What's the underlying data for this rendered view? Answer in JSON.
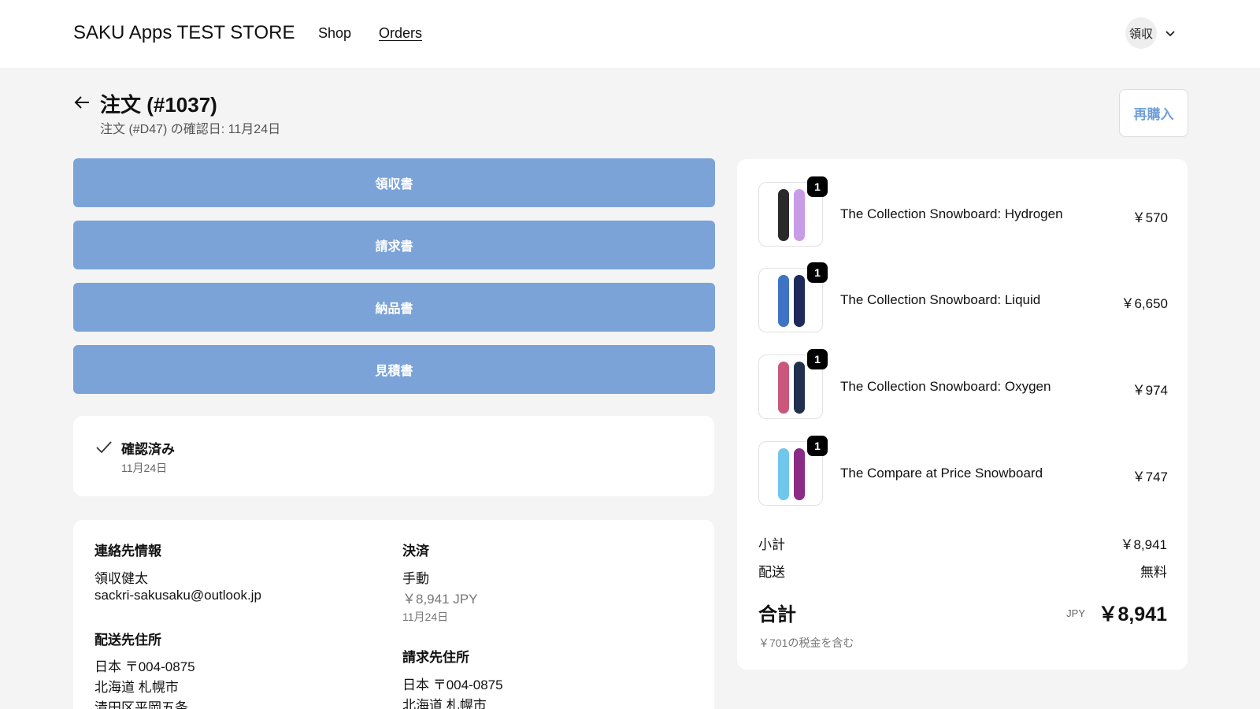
{
  "header": {
    "store_name": "SAKU Apps TEST STORE",
    "nav": {
      "shop": "Shop",
      "orders": "Orders"
    },
    "account_label": "領収"
  },
  "order": {
    "title": "注文 (#1037)",
    "subtitle": "注文 (#D47) の確認日: 11月24日",
    "rebuy_label": "再購入"
  },
  "doc_buttons": [
    "領収書",
    "請求書",
    "納品書",
    "見積書"
  ],
  "status": {
    "label": "確認済み",
    "date": "11月24日"
  },
  "info": {
    "contact_heading": "連絡先情報",
    "contact_name": "領収健太",
    "contact_email": "sackri-sakusaku@outlook.jp",
    "shipping_heading": "配送先住所",
    "shipping_lines": [
      "日本 〒004-0875",
      "北海道 札幌市",
      "清田区平岡五条"
    ],
    "payment_heading": "決済",
    "payment_method": "手動",
    "payment_amount": "￥8,941 JPY",
    "payment_date": "11月24日",
    "billing_heading": "請求先住所",
    "billing_lines": [
      "日本 〒004-0875",
      "北海道 札幌市"
    ]
  },
  "items": [
    {
      "name": "The Collection Snowboard: Hydrogen",
      "price": "￥570",
      "qty": "1",
      "colors": [
        "#2a2a2a",
        "#c99be6"
      ]
    },
    {
      "name": "The Collection Snowboard: Liquid",
      "price": "￥6,650",
      "qty": "1",
      "colors": [
        "#3f74c4",
        "#1d2a5a"
      ]
    },
    {
      "name": "The Collection Snowboard: Oxygen",
      "price": "￥974",
      "qty": "1",
      "colors": [
        "#c9587a",
        "#22304f"
      ]
    },
    {
      "name": "The Compare at Price Snowboard",
      "price": "￥747",
      "qty": "1",
      "colors": [
        "#6fc7ec",
        "#8a2b86"
      ]
    }
  ],
  "summary": {
    "subtotal_label": "小計",
    "subtotal": "￥8,941",
    "shipping_label": "配送",
    "shipping": "無料",
    "total_label": "合計",
    "currency": "JPY",
    "total": "￥8,941",
    "tax_note": "￥701の税金を含む"
  },
  "colors": {
    "accent_button": "#7ba3d8",
    "rebuy_text": "#6f9fd8"
  }
}
